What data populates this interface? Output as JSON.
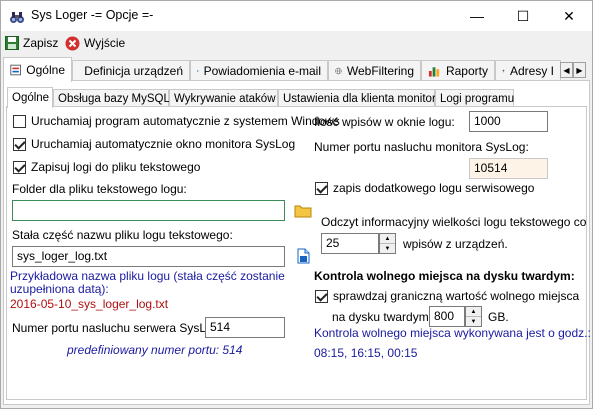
{
  "window": {
    "title": "Sys Loger -= Opcje =-",
    "min_symbol": "—",
    "max_symbol": "☐",
    "close_symbol": "✕"
  },
  "toolbar": {
    "save_label": "Zapisz",
    "exit_label": "Wyjście"
  },
  "outer_tabs": [
    {
      "label": "Ogólne",
      "icon": "settings-page-icon"
    },
    {
      "label": "Definicja urządzeń",
      "icon": "document-icon"
    },
    {
      "label": "Powiadomienia e-mail",
      "icon": "globe-blue-icon"
    },
    {
      "label": "WebFiltering",
      "icon": "globe-icon"
    },
    {
      "label": "Raporty",
      "icon": "bar-chart-icon"
    },
    {
      "label": "Adresy I",
      "icon": "pin-icon"
    }
  ],
  "outer_scroll": {
    "left": "◀",
    "right": "▶"
  },
  "inner_tabs": [
    {
      "label": "Ogólne"
    },
    {
      "label": "Obsługa bazy MySQL"
    },
    {
      "label": "Wykrywanie ataków"
    },
    {
      "label": "Ustawienia dla klienta monitora"
    },
    {
      "label": "Logi programu"
    }
  ],
  "left": {
    "autostart_label": "Uruchamiaj program automatycznie z systemem Windows",
    "autostart_checked": false,
    "auto_monitor_label": "Uruchamiaj automatycznie okno monitora SysLog",
    "auto_monitor_checked": true,
    "save_logs_label": "Zapisuj logi do pliku tekstowego",
    "save_logs_checked": true,
    "folder_label": "Folder dla pliku tekstowego logu:",
    "folder_value": "",
    "constant_name_label": "Stała część nazwu pliku logu tekstowego:",
    "constant_name_value": "sys_loger_log.txt",
    "example_label_line1": "Przykładowa nazwa pliku logu (stała część zostanie",
    "example_label_line2": "uzupełniona datą):",
    "example_value": "2016-05-10_sys_loger_log.txt",
    "server_port_label": "Numer portu nasluchu serwera SysLog:",
    "server_port_value": "514",
    "predefined_port_note": "predefiniowany numer portu: 514"
  },
  "right": {
    "log_entries_label": "Ilość wpisów w oknie logu:",
    "log_entries_value": "1000",
    "monitor_port_label": "Numer portu nasluchu monitora SysLog:",
    "monitor_port_value": "10514",
    "service_log_label": "zapis dodatkowego logu serwisowego",
    "service_log_checked": true,
    "refresh_label": "Odczyt informacyjny wielkości logu tekstowego co",
    "refresh_value": "25",
    "refresh_suffix": "wpisów z urządzeń.",
    "disk_header": "Kontrola wolnego miejsca na dysku twardym:",
    "disk_check_label": "sprawdzaj graniczną wartość wolnego miejsca",
    "disk_check_checked": true,
    "disk_on_label": "na dysku twardym:",
    "disk_value": "800",
    "disk_unit": "GB.",
    "schedule_label": "Kontrola wolnego miejsca wykonywana jest o godz.:",
    "schedule_value": "08:15, 16:15, 00:15"
  },
  "colors": {
    "accent_blue": "#1a1aa0",
    "accent_red": "#b01010",
    "readonly_bg": "#fdf3e6"
  }
}
